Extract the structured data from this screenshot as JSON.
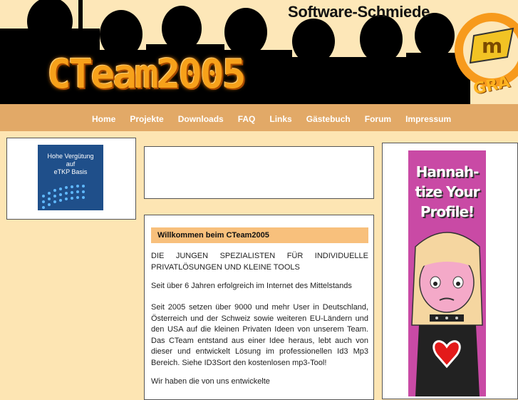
{
  "header": {
    "tagline": "Software-Schmiede",
    "logo": "CTeam2005",
    "badge": "GRA"
  },
  "nav": {
    "items": [
      "Home",
      "Projekte",
      "Downloads",
      "FAQ",
      "Links",
      "Gästebuch",
      "Forum",
      "Impressum"
    ]
  },
  "left_ad": {
    "line1": "Hohe Vergütung",
    "line2": "auf",
    "line3": "eTKP Basis"
  },
  "content": {
    "welcome": "Willkommen beim CTeam2005",
    "p1": "DIE JUNGEN SPEZIALISTEN FÜR INDIVIDUELLE PRIVATLÖSUNGEN UND KLEINE TOOLS",
    "p2": "Seit über 6 Jahren erfolgreich im Internet des Mittelstands",
    "p3": "Seit 2005 setzen über 9000 und mehr User in Deutschland, Österreich und der Schweiz sowie weiteren EU-Ländern und den USA auf die kleinen Privaten Ideen von unserem Team. Das CTeam entstand aus einer Idee heraus, lebt auch von dieser und entwickelt Lösung im professionellen Id3 Mp3 Bereich. Siehe ID3Sort den kostenlosen mp3-Tool!",
    "p4": "Wir haben die von uns entwickelte"
  },
  "right_ad": {
    "line1": "Hannah-",
    "line2": "tize Your",
    "line3": "Profile!"
  },
  "colors": {
    "page_bg": "#fde5b3",
    "nav_bg": "#e2a967",
    "welcome_bar": "#f8c07c",
    "logo_orange": "#f7a11a"
  }
}
